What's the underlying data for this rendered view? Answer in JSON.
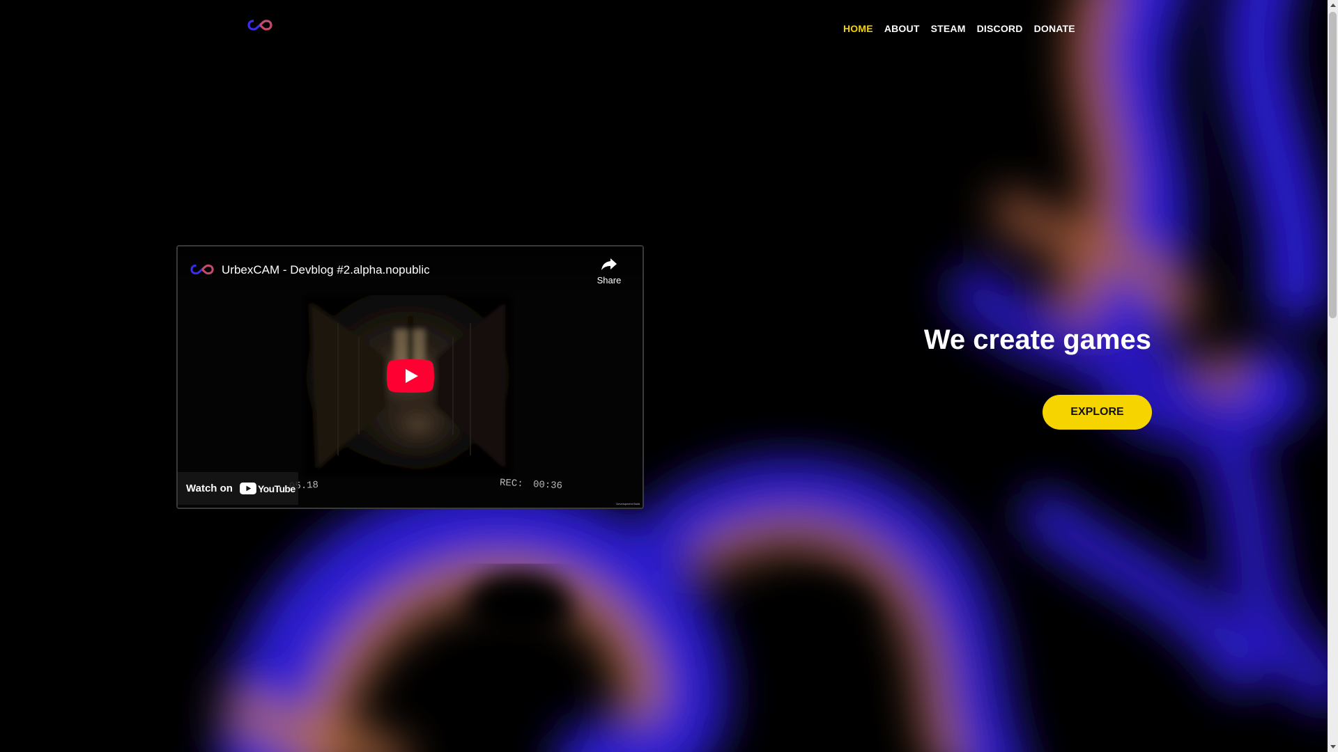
{
  "nav": {
    "items": [
      {
        "label": "HOME",
        "active": true
      },
      {
        "label": "ABOUT"
      },
      {
        "label": "STEAM"
      },
      {
        "label": "DISCORD"
      },
      {
        "label": "DONATE"
      }
    ]
  },
  "video": {
    "title": "UrbexCAM - Devblog #2.alpha.nopublic",
    "share_label": "Share",
    "watch_label": "Watch on",
    "youtube_word": "YouTube",
    "timestamp_left": "05.18",
    "rec_text": "REC: 00:36",
    "dev_text": "Development Build"
  },
  "hero": {
    "title": "We create games",
    "button_label": "EXPLORE"
  },
  "colors": {
    "accent": "#f5d400",
    "background": "#000000",
    "swirl_blue": "#2b1bd6",
    "swirl_orange": "#b0603a"
  },
  "icons": {
    "logo": "infinity-icon",
    "share": "share-icon",
    "play": "play-icon"
  }
}
